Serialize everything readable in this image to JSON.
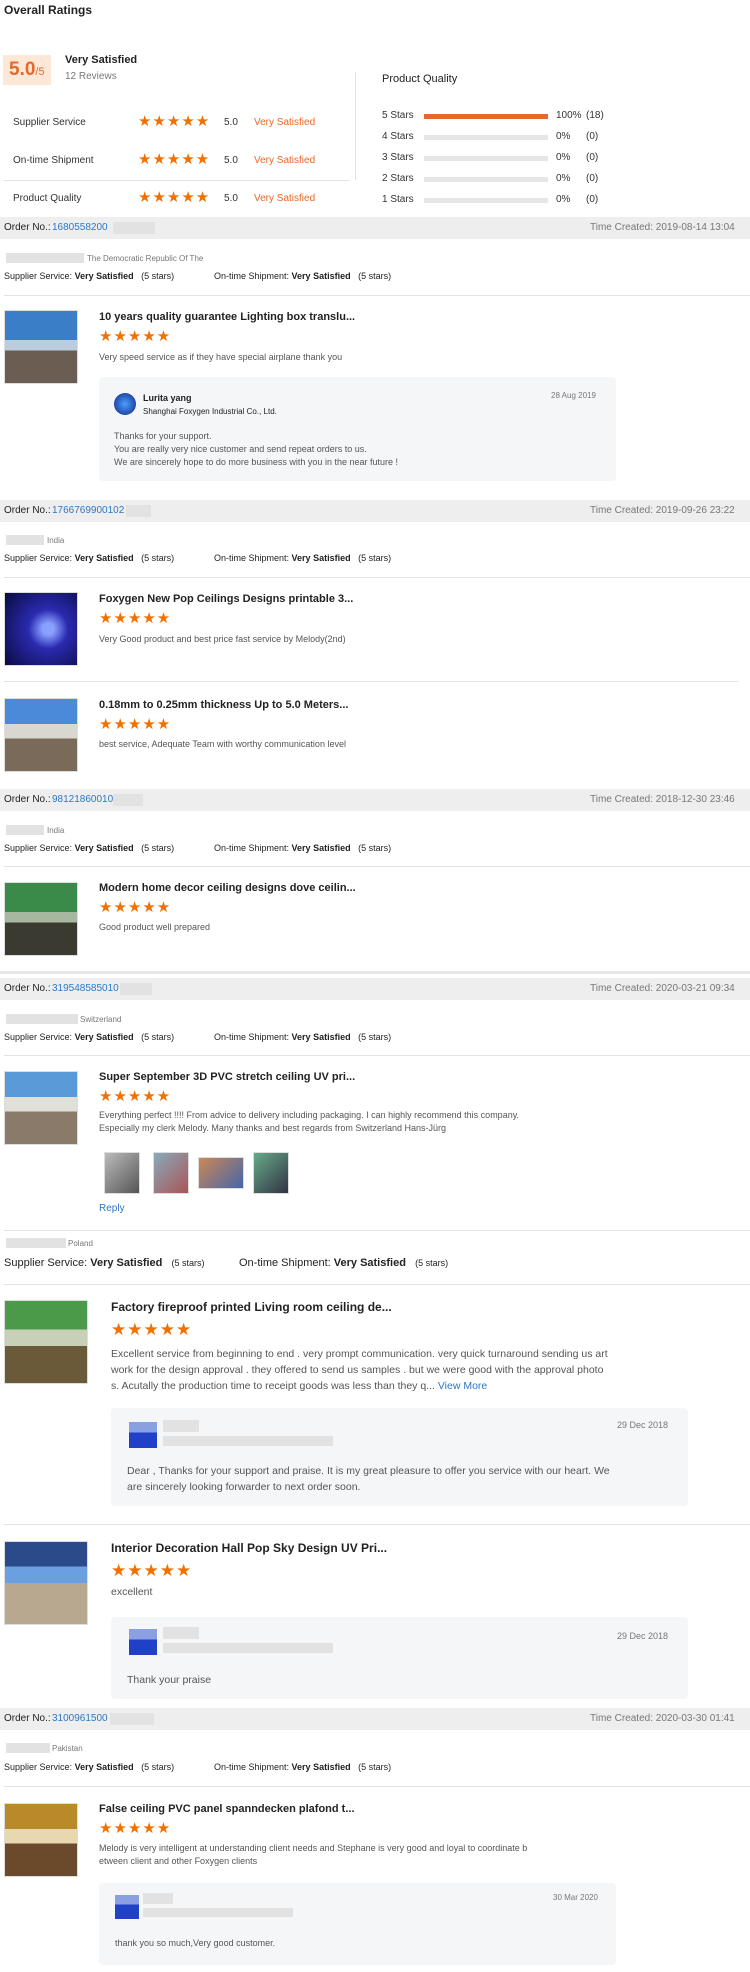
{
  "header": {
    "title": "Overall Ratings",
    "score": "5.0",
    "score_max": "/5",
    "satisfaction": "Very Satisfied",
    "reviews": "12 Reviews"
  },
  "ratings": [
    {
      "label": "Supplier Service",
      "value": "5.0",
      "text": "Very Satisfied"
    },
    {
      "label": "On-time Shipment",
      "value": "5.0",
      "text": "Very Satisfied"
    },
    {
      "label": "Product Quality",
      "value": "5.0",
      "text": "Very Satisfied"
    }
  ],
  "product_quality": {
    "title": "Product Quality",
    "rows": [
      {
        "label": "5 Stars",
        "pct": "100%",
        "count": "(18)",
        "fill": 1.0
      },
      {
        "label": "4 Stars",
        "pct": "0%",
        "count": "(0)",
        "fill": 0
      },
      {
        "label": "3 Stars",
        "pct": "0%",
        "count": "(0)",
        "fill": 0
      },
      {
        "label": "2 Stars",
        "pct": "0%",
        "count": "(0)",
        "fill": 0
      },
      {
        "label": "1 Stars",
        "pct": "0%",
        "count": "(0)",
        "fill": 0
      }
    ]
  },
  "common": {
    "order_no": "Order No.:",
    "time_created": "Time Created:",
    "supplier_service": "Supplier Service:",
    "ontime": "On-time Shipment:",
    "very_satisfied": "Very Satisfied",
    "five_stars": "(5 stars)",
    "star_glyphs": "★★★★★"
  },
  "orders": [
    {
      "no": "1680558200",
      "time": "2019-08-14 13:04",
      "country": "The Democratic Republic Of The"
    },
    {
      "no": "1766769900102",
      "time": "2019-09-26 23:22",
      "country": "India"
    },
    {
      "no": "98121860010",
      "time": "2018-12-30 23:46",
      "country": "India"
    },
    {
      "no": "319548585010",
      "time": "2020-03-21 09:34",
      "country": "Switzerland"
    },
    {
      "no": "",
      "time": "",
      "country": "Poland"
    },
    {
      "no": "3100961500",
      "time": "2020-03-30 01:41",
      "country": "Pakistan"
    }
  ],
  "products": [
    {
      "name": "10 years quality guarantee Lighting box translu...",
      "review": "Very speed service as if they have special airplane thank you"
    },
    {
      "name": "Foxygen New Pop Ceilings Designs printable 3...",
      "review": "Very Good product and best price fast service by Melody(2nd)"
    },
    {
      "name": "0.18mm to 0.25mm thickness Up to 5.0 Meters...",
      "review": "best service, Adequate Team with worthy communication level"
    },
    {
      "name": "Modern home decor ceiling designs dove ceilin...",
      "review": "Good product well prepared"
    },
    {
      "name": "Super September 3D PVC stretch ceiling UV pri...",
      "review1": "Everything perfect !!!!  From advice to delivery including packaging.  I can highly recommend this company.",
      "review2": "Especially my clerk Melody.  Many thanks and best regards from Switzerland Hans-Jürg",
      "reply_link": "Reply"
    },
    {
      "name": "Factory fireproof printed Living room ceiling de...",
      "review1": "Excellent service from beginning to end . very prompt communication. very quick turnaround sending us art",
      "review2": "work  for the design approval . they offered to send us samples . but we were good with the approval photo",
      "review3": "s. Acutally the production time to receipt goods was less than they q...",
      "more": "View More"
    },
    {
      "name": "Interior Decoration Hall Pop Sky Design UV Pri...",
      "review": "excellent"
    },
    {
      "name": "False ceiling PVC panel spanndecken plafond t...",
      "review1": "Melody is very intelligent at understanding client needs and Stephane is very good and loyal to coordinate b",
      "review2": "etween client and other Foxygen clients"
    }
  ],
  "replies": {
    "r1": {
      "name": "Lurita yang",
      "company": "Shanghai Foxygen Industrial Co., Ltd.",
      "date": "28 Aug 2019",
      "line1": "Thanks for your support.",
      "line2": "You are really very nice customer and send repeat orders to us.",
      "line3": "We are sincerely hope to do more business with you in the near future !"
    },
    "r2": {
      "date": "29 Dec 2018",
      "line1": "Dear , Thanks for your support and praise.  It is my great pleasure to offer you service with our heart.  We",
      "line2": "are sincerely looking forwarder to next order soon."
    },
    "r3": {
      "date": "29 Dec 2018",
      "line1": "Thank your praise"
    },
    "r4": {
      "date": "30 Mar 2020",
      "line1": "thank you so much,Very good customer."
    }
  },
  "colors": {
    "accent": "#e7682a",
    "link": "#2a78c8",
    "bar": "#eeeeee"
  }
}
